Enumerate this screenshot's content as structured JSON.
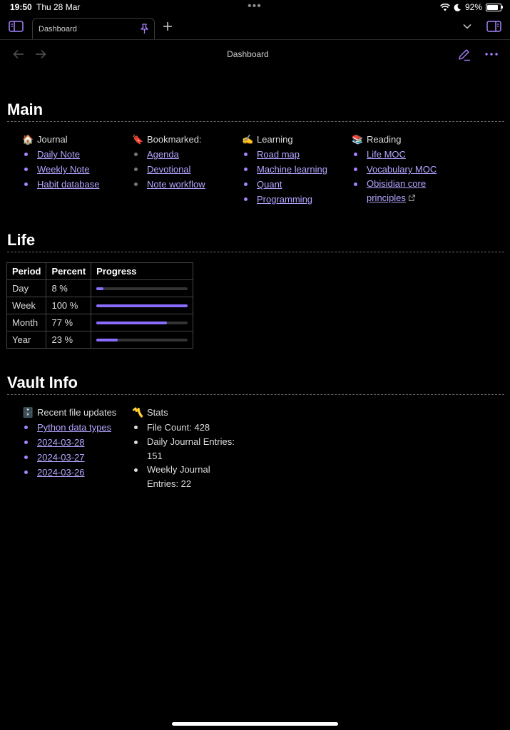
{
  "status": {
    "time": "19:50",
    "date": "Thu 28 Mar",
    "battery": "92%",
    "battery_level": 92
  },
  "tab": {
    "title": "Dashboard"
  },
  "view": {
    "title": "Dashboard"
  },
  "icons": {
    "sidebar_left": "sidebar-left-icon",
    "pin": "pin-icon",
    "new_tab": "plus-icon",
    "tab_list": "chevron-down-icon",
    "sidebar_right": "sidebar-right-icon",
    "back": "arrow-left-icon",
    "forward": "arrow-right-icon",
    "edit": "pencil-icon",
    "more": "more-horizontal-icon"
  },
  "colors": {
    "accent": "#a882ff",
    "link": "#b6a4ff",
    "background": "#000000"
  },
  "main": {
    "heading": "Main",
    "columns": [
      {
        "emoji": "🏠",
        "title": "Journal",
        "items": [
          "Daily Note",
          "Weekly Note",
          "Habit database"
        ]
      },
      {
        "emoji": "🔖",
        "title": "Bookmarked:",
        "items": [
          "Agenda",
          "Devotional",
          "Note workflow"
        ]
      },
      {
        "emoji": "✍️",
        "title": "Learning",
        "items": [
          "Road map",
          "Machine learning",
          "Quant",
          "Programming"
        ]
      },
      {
        "emoji": "📚",
        "title": "Reading",
        "items": [
          "Life MOC",
          "Vocabulary MOC",
          "Obisidian core principles"
        ]
      }
    ]
  },
  "life": {
    "heading": "Life",
    "headers": [
      "Period",
      "Percent",
      "Progress"
    ],
    "rows": [
      {
        "period": "Day",
        "percent": "8 %",
        "value": 8
      },
      {
        "period": "Week",
        "percent": "100 %",
        "value": 100
      },
      {
        "period": "Month",
        "percent": "77 %",
        "value": 77
      },
      {
        "period": "Year",
        "percent": "23 %",
        "value": 23
      }
    ]
  },
  "vault": {
    "heading": "Vault Info",
    "recent": {
      "emoji": "🗄️",
      "title": "Recent file updates",
      "items": [
        "Python data types",
        "2024-03-28",
        "2024-03-27",
        "2024-03-26"
      ]
    },
    "stats": {
      "emoji": "〽️",
      "title": "Stats",
      "items": [
        "File Count: 428",
        "Daily Journal Entries: 151",
        "Weekly Journal Entries: 22"
      ]
    }
  }
}
